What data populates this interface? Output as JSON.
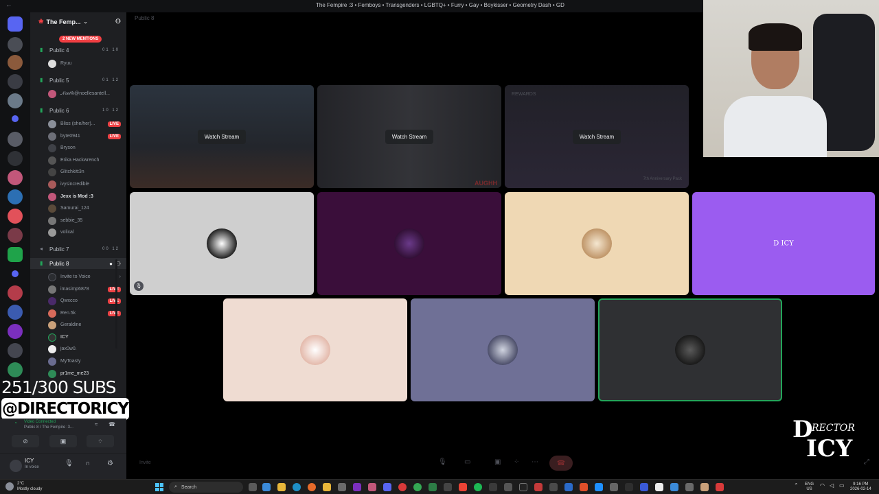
{
  "window": {
    "title": "The Fempire :3 • Femboys • Transgenders • LGBTQ+ • Furry • Gay • Boykisser • Geometry Dash • GD",
    "back_glyph": "←"
  },
  "guild": {
    "name": "The Femp...",
    "mentions": "2 NEW MENTIONS"
  },
  "channels": [
    {
      "name": "Public 4",
      "counts": "01 10"
    },
    {
      "name": "Public 5",
      "counts": "01 12"
    },
    {
      "name": "Public 6",
      "counts": "10 12"
    },
    {
      "name": "Public 7",
      "counts": "00 12"
    },
    {
      "name": "Public 8",
      "counts": ""
    }
  ],
  "members_public4": [
    {
      "name": "Ryuu"
    }
  ],
  "members_public5": [
    {
      "name": "𝒩𝑜𝑒𝓁𝓁𝑒@noellesantell..."
    }
  ],
  "members_public6": [
    {
      "name": "Bliss (she/her)...",
      "badge": "LIVE"
    },
    {
      "name": "byte0941",
      "badge": "LIVE"
    },
    {
      "name": "Bryson",
      "badge": ""
    },
    {
      "name": "Erika Hackwrench",
      "badge": ""
    },
    {
      "name": "Glitchkitt3n",
      "badge": ""
    },
    {
      "name": "ivysincredible",
      "badge": ""
    },
    {
      "name": "Jexx is Mod :3",
      "badge": ""
    },
    {
      "name": "Samurai_124",
      "badge": ""
    },
    {
      "name": "sebbie_35",
      "badge": ""
    },
    {
      "name": "volixal",
      "badge": ""
    }
  ],
  "members_public8": [
    {
      "name": "Invite to Voice",
      "badge": ""
    },
    {
      "name": "imasimp6878",
      "badge": "LIVE"
    },
    {
      "name": "Qwxcco",
      "badge": "LIVE"
    },
    {
      "name": "Ren.5k",
      "badge": "LIVE"
    },
    {
      "name": "Geraldine",
      "badge": ""
    },
    {
      "name": "ICY",
      "badge": ""
    },
    {
      "name": "jax0w0.",
      "badge": ""
    },
    {
      "name": "MyToasty",
      "badge": ""
    },
    {
      "name": "pr1me_me23",
      "badge": ""
    }
  ],
  "overlay": {
    "subs": "251/300 SUBS",
    "handle": "@DIRECTORICY"
  },
  "voice": {
    "status": "Video Connected",
    "location": "Public 8 / The Fempire :3..."
  },
  "user_panel": {
    "name": "ICY",
    "status": "In voice"
  },
  "stage": {
    "channel": "Public 8",
    "watch_label": "Watch Stream",
    "tag_rewards": "REWARDS",
    "tag_augh": "AUGHH",
    "tag_anniversary": "7th Anniversary Pack",
    "tile_text": "D ICY",
    "invite": "Invite"
  },
  "logo": {
    "line1": "D",
    "line2": "RECTOR",
    "line3": "ICY"
  },
  "taskbar": {
    "weather_temp": "2°C",
    "weather_desc": "Mostly cloudy",
    "search": "Search",
    "lang": "ENG",
    "region": "US",
    "time": "9:16 PM",
    "date": "2026-02-14"
  }
}
